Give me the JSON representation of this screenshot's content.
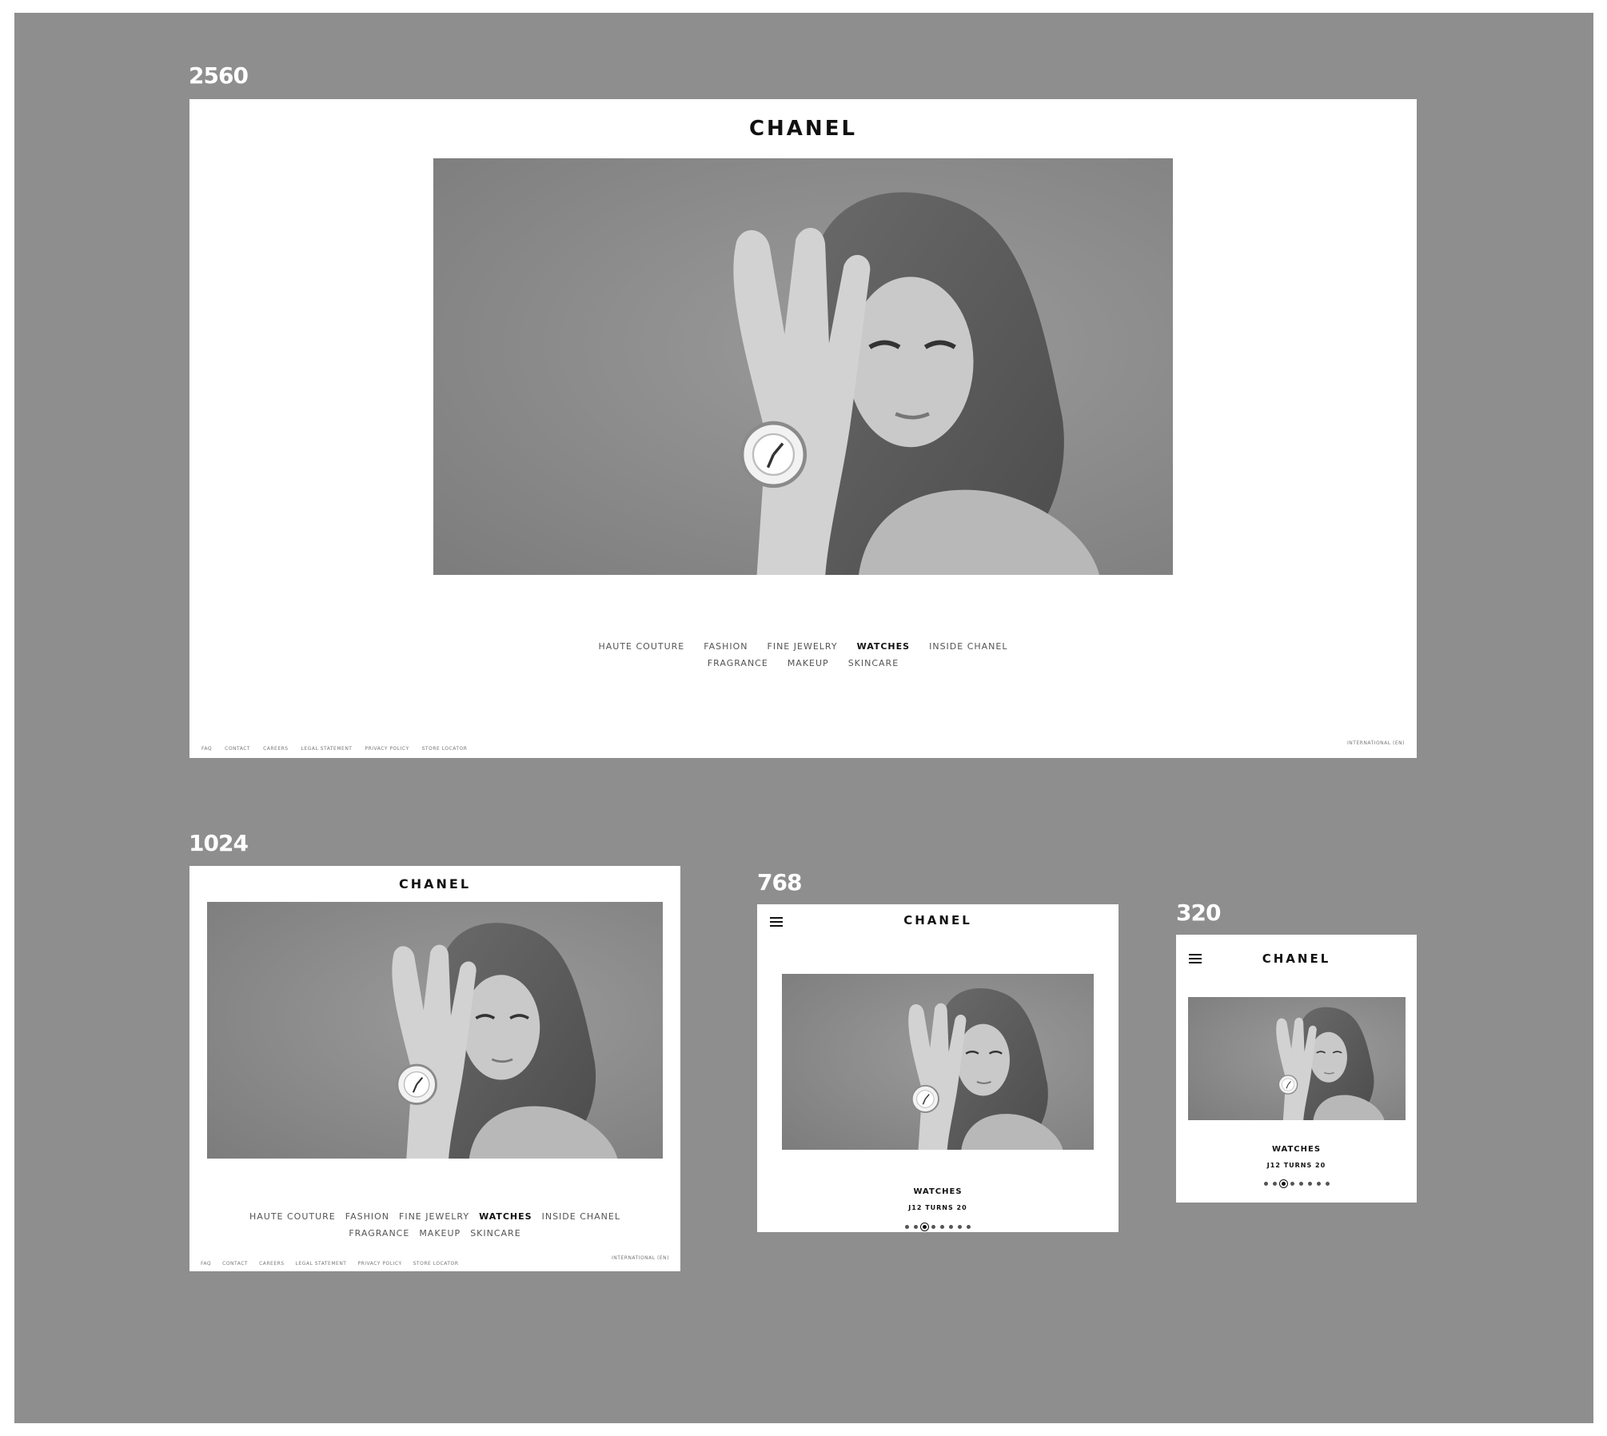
{
  "breakpoints": {
    "desktop_xl": "2560",
    "desktop": "1024",
    "tablet": "768",
    "mobile": "320"
  },
  "brand": {
    "logo": "CHANEL"
  },
  "hero": {
    "image": "black-and-white portrait of a woman wearing a white watch"
  },
  "nav": {
    "row1": [
      "HAUTE COUTURE",
      "FASHION",
      "FINE JEWELRY",
      "WATCHES",
      "INSIDE CHANEL"
    ],
    "row2": [
      "FRAGRANCE",
      "MAKEUP",
      "SKINCARE"
    ],
    "active": "WATCHES"
  },
  "footer": {
    "links": [
      "FAQ",
      "CONTACT",
      "CAREERS",
      "LEGAL STATEMENT",
      "PRIVACY POLICY",
      "STORE LOCATOR"
    ],
    "locale": "INTERNATIONAL (EN)"
  },
  "carousel": {
    "category": "WATCHES",
    "subtitle": "J12 TURNS 20",
    "slide_count": 8,
    "active_slide": 3
  },
  "icons": {
    "menu": "hamburger-menu-icon"
  },
  "colors": {
    "canvas": "#8e8e8e",
    "frame": "#ffffff",
    "text": "#111111",
    "nav_text": "#555555"
  }
}
